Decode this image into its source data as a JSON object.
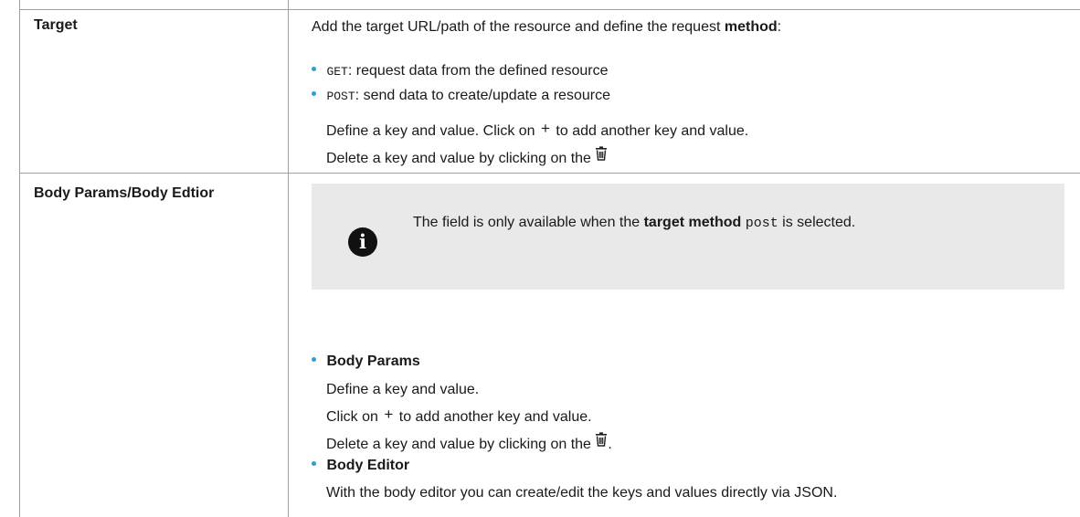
{
  "rows": [
    {
      "label": "Target",
      "intro": {
        "before": "Add the target URL/path of the resource and define the request ",
        "bold": "method",
        "after": ":"
      },
      "bullets": [
        {
          "code": "GET",
          "text": ": request data from the defined resource"
        },
        {
          "code": "POST",
          "text": ": send data to create/update a resource"
        }
      ],
      "define_before": "Define a key and value. Click on ",
      "plus": "+",
      "define_after": " to add another key and value.",
      "delete_text": "Delete a key and value by clicking on the "
    },
    {
      "label": "Body Params/Body Edtior",
      "note": {
        "icon": "info-icon",
        "icon_glyph": "i",
        "before": "The field is only available when the ",
        "bold": "target method",
        "code": "post",
        "after": " is selected."
      },
      "body_params": {
        "title": "Body Params",
        "line1": "Define a key and value.",
        "line2_before": "Click on ",
        "plus": "+",
        "line2_after": " to add another key and value.",
        "line3_before": "Delete a key and value by clicking on the ",
        "line3_after": "."
      },
      "body_editor": {
        "title": "Body Editor",
        "line1": "With the body editor you can create/edit the keys and values directly via JSON."
      }
    }
  ],
  "colors": {
    "bullet": "#2a9fd6",
    "note_bg": "#e9e9e9",
    "border": "#9aa0a6"
  }
}
